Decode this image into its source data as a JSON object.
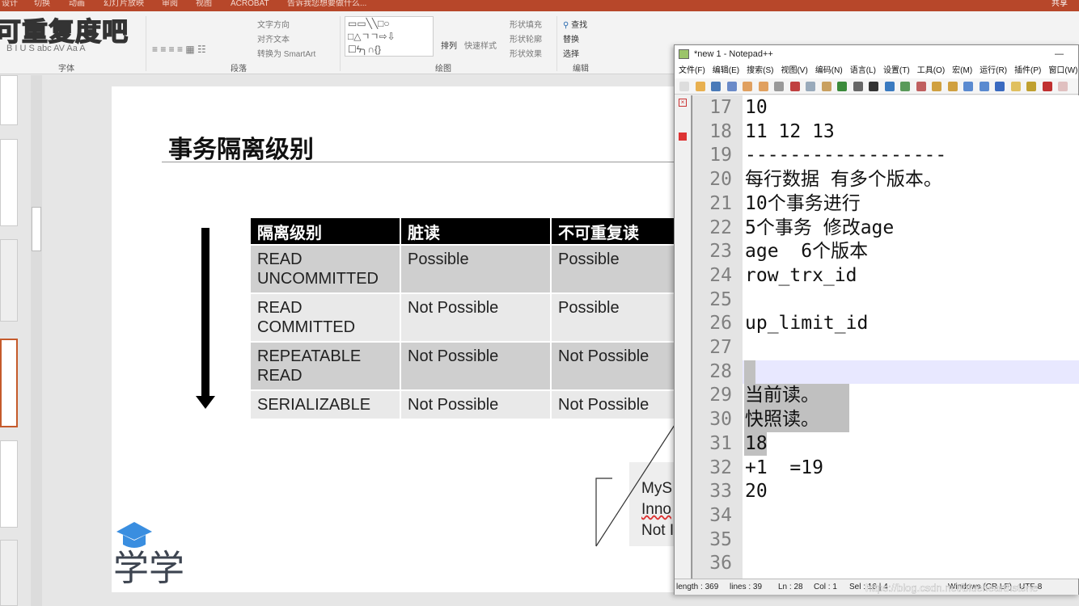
{
  "ppt": {
    "tabs": [
      "设计",
      "切换",
      "动画",
      "幻灯片放映",
      "审阅",
      "视图",
      "ACROBAT"
    ],
    "tell_me": "告诉我您想要做什么...",
    "share": "共享",
    "ribbon": {
      "font_group": "字体",
      "paragraph_group": "段落",
      "drawing_group": "绘图",
      "editing_group": "编辑",
      "text_direction": "文字方向",
      "align_text": "对齐文本",
      "convert_smartart": "转换为 SmartArt",
      "arrange": "排列",
      "quick_styles": "快速样式",
      "shape_fill": "形状填充",
      "shape_outline": "形状轮廓",
      "shape_effects": "形状效果",
      "find": "查找",
      "replace": "替换",
      "select": "选择"
    },
    "video_caption": "可重复度吧",
    "slide": {
      "title": "事务隔离级别",
      "table": {
        "headers": [
          "隔离级别",
          "脏读",
          "不可重复读"
        ],
        "rows": [
          [
            "READ\nUNCOMMITTED",
            "Possible",
            "Possible"
          ],
          [
            "READ\nCOMMITTED",
            "Not Possible",
            "Possible"
          ],
          [
            "REPEATABLE\nREAD",
            "Not Possible",
            "Not Possible"
          ],
          [
            "SERIALIZABLE",
            "Not Possible",
            "Not Possible"
          ]
        ]
      },
      "note_lines": [
        "MyS",
        "Inno",
        "Not I"
      ],
      "logo": "学学"
    }
  },
  "notepad": {
    "title": "*new 1 - Notepad++",
    "menu": [
      "文件(F)",
      "编辑(E)",
      "搜索(S)",
      "视图(V)",
      "编码(N)",
      "语言(L)",
      "设置(T)",
      "工具(O)",
      "宏(M)",
      "运行(R)",
      "插件(P)",
      "窗口(W)"
    ],
    "lines": [
      {
        "n": "17",
        "text": "10"
      },
      {
        "n": "18",
        "text": "11 12 13"
      },
      {
        "n": "19",
        "text": "------------------"
      },
      {
        "n": "20",
        "text": "每行数据 有多个版本。"
      },
      {
        "n": "21",
        "text": "10个事务进行"
      },
      {
        "n": "22",
        "text": "5个事务 修改age"
      },
      {
        "n": "23",
        "text": "age  6个版本"
      },
      {
        "n": "24",
        "text": "row_trx_id"
      },
      {
        "n": "25",
        "text": ""
      },
      {
        "n": "26",
        "text": "up_limit_id"
      },
      {
        "n": "27",
        "text": ""
      },
      {
        "n": "28",
        "text": ""
      },
      {
        "n": "29",
        "text": "当前读。"
      },
      {
        "n": "30",
        "text": "快照读。"
      },
      {
        "n": "31",
        "text": "18"
      },
      {
        "n": "32",
        "text": "+1  =19"
      },
      {
        "n": "33",
        "text": "20"
      },
      {
        "n": "34",
        "text": ""
      },
      {
        "n": "35",
        "text": ""
      },
      {
        "n": "36",
        "text": ""
      }
    ],
    "current_line": "28",
    "status": {
      "length": "length : 369",
      "lines": "lines : 39",
      "ln": "Ln : 28",
      "col": "Col : 1",
      "sel": "Sel : 16 | 4",
      "eol": "Windows (CR LF)",
      "encoding": "UTF-8"
    }
  },
  "watermark": "https://blog.csdn.net/bluehearthstone",
  "colors": {
    "ppt_accent": "#b7472a",
    "selection": "#c0c0c0",
    "current_line": "#e8e8ff"
  }
}
